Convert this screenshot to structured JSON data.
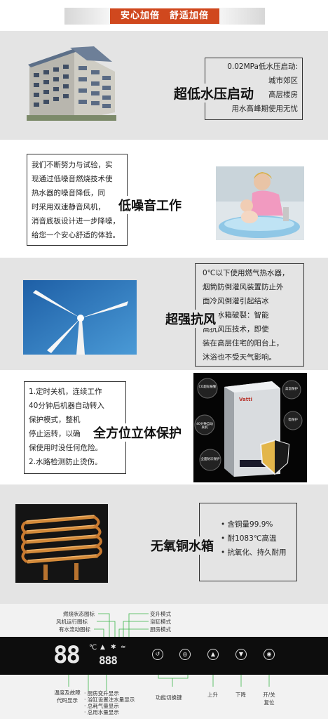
{
  "header": {
    "title": "安心加倍　舒适加倍"
  },
  "sections": [
    {
      "heading": "超低水压启动",
      "lines": [
        "0.02MPa低水压启动:",
        "城市郊区",
        "高层楼房",
        "用水高峰期使用无忧"
      ]
    },
    {
      "heading": "低噪音工作",
      "lines": [
        "我们不断努力与试验，实",
        "现通过低噪音燃烧技术使",
        "热水器的噪音降低，同",
        "时采用双速静音风机，",
        "消音底板设计进一步降噪，",
        "给您一个安心舒适的体验。"
      ]
    },
    {
      "heading": "超强抗风",
      "lines": [
        "0℃以下使用燃气热水器，",
        "烟筒防倒灌风装置防止外",
        "面冷风倒灌引起结冰",
        "导致水箱破裂：智能",
        "高抗风压技术，即使",
        "装在高层住宅的阳台上，",
        "沐浴也不受天气影响。"
      ]
    },
    {
      "heading": "全方位立体保护",
      "lines": [
        "1.定时关机，连续工作",
        "40分钟后机器自动转入",
        "保护模式，整机",
        "停止运转，以确",
        "保使用时没任何危险。",
        "2.水路检测防止烫伤。"
      ],
      "bubbles": [
        "CO超标报警",
        "40分钟自动关机",
        "高温保护",
        "全面防冻保护",
        "电保护"
      ],
      "brand": "Vatti"
    },
    {
      "heading": "无氧铜水箱",
      "lines": [
        "• 含铜量99.9%",
        "• 耐1083℃高温",
        "• 抗氧化、持久耐用"
      ]
    }
  ],
  "panel": {
    "top_labels_left": [
      "燃烧状态图标",
      "风机运行图标",
      "有水流动图标"
    ],
    "top_labels_right": [
      "变升模式",
      "浴缸模式",
      "厨房模式"
    ],
    "display_big": "88",
    "display_unit": "℃",
    "display_small": "888",
    "bottom_label_temp": "温度及故障代码显示",
    "bottom_list": [
      "· 厨房变升显示",
      "· 浴缸设置注水量显示",
      "· 总耗气量显示",
      "· 总用水量显示"
    ],
    "bottom_func": "功能切换键",
    "bottom_up": "上升",
    "bottom_down": "下降",
    "bottom_power": "开/关复位",
    "colors": {
      "accent": "#d0481e",
      "gray_band": "#e4e4e4",
      "panel": "#0d0d0d",
      "led": "#e8e8e8",
      "pointer": "#3bb54a"
    }
  }
}
